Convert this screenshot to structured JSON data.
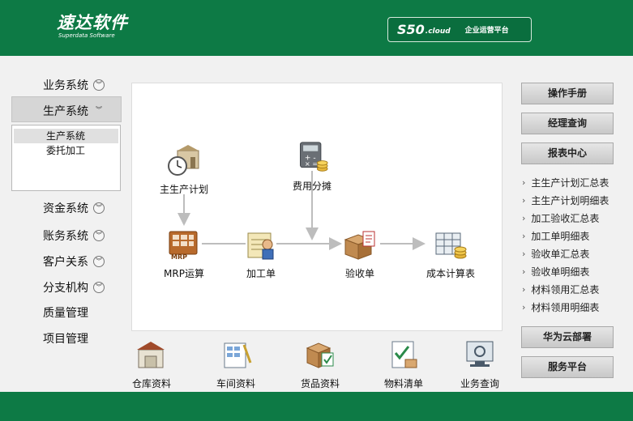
{
  "header": {
    "logo_cn": "速达软件",
    "logo_en": "Superdata Software",
    "product": "S50",
    "product_suffix": ".cloud",
    "product_subtitle": "企业运营平台"
  },
  "sidebar": {
    "items": [
      {
        "label": "业务系统"
      },
      {
        "label": "生产系统"
      },
      {
        "label": "资金系统"
      },
      {
        "label": "账务系统"
      },
      {
        "label": "客户关系"
      },
      {
        "label": "分支机构"
      },
      {
        "label": "质量管理"
      },
      {
        "label": "项目管理"
      }
    ],
    "submenu": [
      "生产系统",
      "委托加工"
    ]
  },
  "flow": {
    "nodes": {
      "main_plan": "主生产计划",
      "cost_alloc": "费用分摊",
      "mrp": "MRP运算",
      "process_order": "加工单",
      "acceptance": "验收单",
      "cost_calc": "成本计算表"
    },
    "bottom": [
      "仓库资料",
      "车间资料",
      "货品资料",
      "物料清单",
      "业务查询"
    ]
  },
  "right": {
    "buttons": [
      "操作手册",
      "经理查询",
      "报表中心",
      "华为云部署",
      "服务平台"
    ],
    "reports": [
      "主生产计划汇总表",
      "主生产计划明细表",
      "加工验收汇总表",
      "加工单明细表",
      "验收单汇总表",
      "验收单明细表",
      "材料领用汇总表",
      "材料领用明细表"
    ]
  },
  "colors": {
    "brand_green": "#0d7a45",
    "background": "#f1f1f1"
  }
}
